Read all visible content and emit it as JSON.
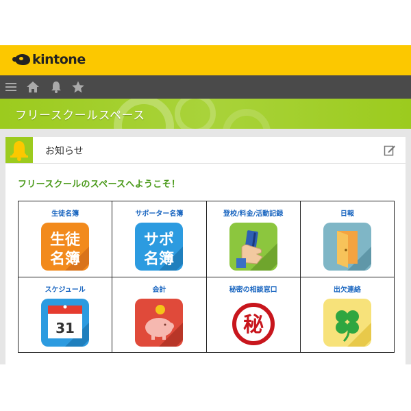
{
  "app": {
    "logo_text": "kintone",
    "brand_color": "#fcc800"
  },
  "nav": {
    "icons": [
      "menu-icon",
      "home-icon",
      "bell-icon",
      "star-icon"
    ]
  },
  "space": {
    "title": "フリースクールスペース",
    "accent_color": "#9ccb1e"
  },
  "notice": {
    "title": "お知らせ",
    "welcome_text": "フリースクールのスペースへようこそ！",
    "edit_icon": "pencil-icon"
  },
  "apps": [
    {
      "label": "生徒名簿",
      "icon": "student-roster-icon",
      "icon_text": [
        "生徒",
        "名簿"
      ]
    },
    {
      "label": "サポーター名簿",
      "icon": "supporter-roster-icon",
      "icon_text": [
        "サポ",
        "名簿"
      ]
    },
    {
      "label": "登校/料金/活動記録",
      "icon": "card-hand-icon"
    },
    {
      "label": "日報",
      "icon": "door-icon"
    },
    {
      "label": "スケジュール",
      "icon": "calendar-icon",
      "icon_text": [
        "31"
      ]
    },
    {
      "label": "会計",
      "icon": "piggy-bank-icon"
    },
    {
      "label": "秘密の相談窓口",
      "icon": "secret-stamp-icon",
      "icon_text": [
        "秘"
      ]
    },
    {
      "label": "出欠連絡",
      "icon": "clover-icon"
    }
  ]
}
